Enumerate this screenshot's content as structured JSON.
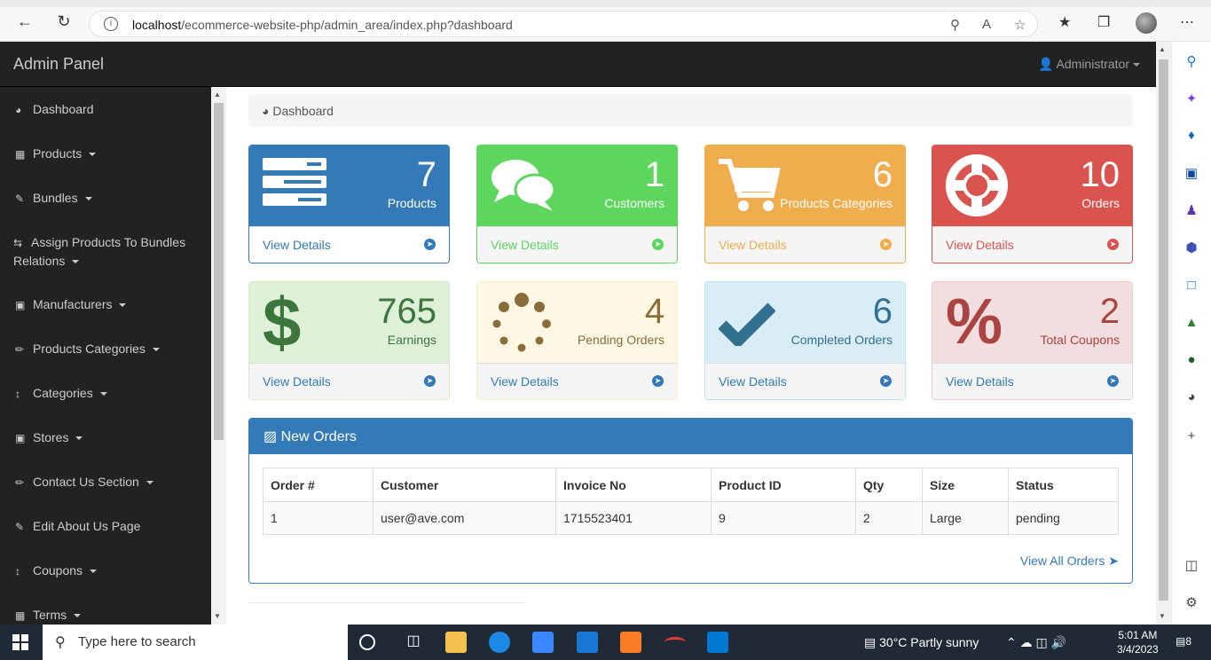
{
  "browser": {
    "url_host": "localhost",
    "url_path": "/ecommerce-website-php/admin_area/index.php?dashboard"
  },
  "header": {
    "brand": "Admin Panel",
    "user": "Administrator"
  },
  "sidebar": {
    "items": [
      {
        "label": "Dashboard",
        "icon": "dashboard-icon"
      },
      {
        "label": "Products",
        "icon": "table-icon"
      },
      {
        "label": "Bundles",
        "icon": "edit-icon"
      },
      {
        "label": "Assign Products To Bundles",
        "label2": "Relations",
        "icon": "retweet-icon"
      },
      {
        "label": "Manufacturers",
        "icon": "briefcase-icon"
      },
      {
        "label": "Products Categories",
        "icon": "pencil-icon"
      },
      {
        "label": "Categories",
        "icon": "arrows-v-icon"
      },
      {
        "label": "Stores",
        "icon": "briefcase-icon"
      },
      {
        "label": "Contact Us Section",
        "icon": "pencil-icon"
      },
      {
        "label": "Edit About Us Page",
        "icon": "edit-icon"
      },
      {
        "label": "Coupons",
        "icon": "arrows-v-icon"
      },
      {
        "label": "Terms",
        "icon": "table-icon"
      }
    ]
  },
  "breadcrumb": "Dashboard",
  "panels": [
    {
      "value": "7",
      "label": "Products",
      "link": "View Details",
      "color": "#337ab7"
    },
    {
      "value": "1",
      "label": "Customers",
      "link": "View Details",
      "color": "#5cd65c"
    },
    {
      "value": "6",
      "label": "Products Categories",
      "link": "View Details",
      "color": "#f0ad4e"
    },
    {
      "value": "10",
      "label": "Orders",
      "link": "View Details",
      "color": "#d9534f"
    },
    {
      "value": "765",
      "label": "Earnings",
      "link": "View Details",
      "color": "#3c763d"
    },
    {
      "value": "4",
      "label": "Pending Orders",
      "link": "View Details",
      "color": "#8a6d3b"
    },
    {
      "value": "6",
      "label": "Completed Orders",
      "link": "View Details",
      "color": "#31708f"
    },
    {
      "value": "2",
      "label": "Total Coupons",
      "link": "View Details",
      "color": "#a94442"
    }
  ],
  "orders": {
    "title": "New Orders",
    "columns": [
      "Order #",
      "Customer",
      "Invoice No",
      "Product ID",
      "Qty",
      "Size",
      "Status"
    ],
    "rows": [
      [
        "1",
        "user@ave.com",
        "1715523401",
        "9",
        "2",
        "Large",
        "pending"
      ]
    ],
    "view_all": "View All Orders"
  },
  "taskbar": {
    "search_placeholder": "Type here to search",
    "weather": "30°C  Partly sunny",
    "time": "5:01 AM",
    "date": "3/4/2023",
    "notifications": "8"
  }
}
